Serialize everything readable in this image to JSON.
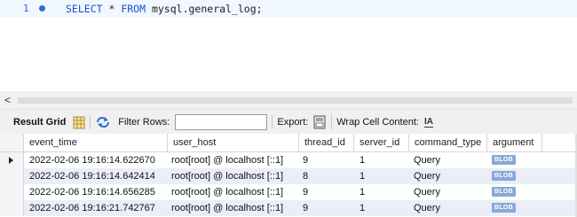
{
  "editor": {
    "line_number": "1",
    "sql_keyword1": "SELECT",
    "sql_star": " * ",
    "sql_keyword2": "FROM",
    "sql_rest": " mysql.general_log;"
  },
  "scrollbar": {
    "left_arrow": "<"
  },
  "toolbar": {
    "result_grid_label": "Result Grid",
    "filter_rows_label": "Filter Rows:",
    "filter_rows_value": "",
    "export_label": "Export:",
    "wrap_cell_label": "Wrap Cell Content:",
    "wrap_icon_text": "IA"
  },
  "grid": {
    "columns": [
      "event_time",
      "user_host",
      "thread_id",
      "server_id",
      "command_type",
      "argument"
    ],
    "rows": [
      [
        "2022-02-06 19:16:14.622670",
        "root[root] @ localhost [::1]",
        "9",
        "1",
        "Query",
        "BLOB"
      ],
      [
        "2022-02-06 19:16:14.642414",
        "root[root] @ localhost [::1]",
        "8",
        "1",
        "Query",
        "BLOB"
      ],
      [
        "2022-02-06 19:16:14.656285",
        "root[root] @ localhost [::1]",
        "9",
        "1",
        "Query",
        "BLOB"
      ],
      [
        "2022-02-06 19:16:21.742767",
        "root[root] @ localhost [::1]",
        "9",
        "1",
        "Query",
        "BLOB"
      ]
    ]
  },
  "colors": {
    "keyword": "#1c52c9",
    "alt_row": "#e9eef8",
    "blob_badge": "#8aa8d4"
  }
}
